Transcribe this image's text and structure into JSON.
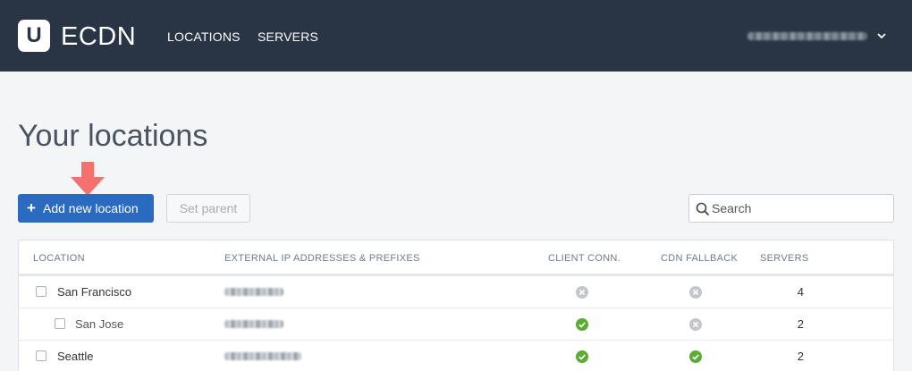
{
  "app": {
    "brand": "ECDN",
    "logo_letter": "U"
  },
  "nav": [
    {
      "label": "LOCATIONS"
    },
    {
      "label": "SERVERS"
    }
  ],
  "page": {
    "title": "Your locations"
  },
  "toolbar": {
    "add_label": "Add new location",
    "set_parent_label": "Set parent"
  },
  "search": {
    "placeholder": "Search"
  },
  "table": {
    "columns": [
      "LOCATION",
      "EXTERNAL IP ADDRESSES & PREFIXES",
      "CLIENT CONN.",
      "CDN FALLBACK",
      "SERVERS"
    ],
    "rows": [
      {
        "location": "San Francisco",
        "client_conn": "disabled",
        "cdn_fallback": "disabled",
        "servers": "4"
      },
      {
        "location": "San Jose",
        "client_conn": "enabled",
        "cdn_fallback": "disabled",
        "servers": "2"
      },
      {
        "location": "Seattle",
        "client_conn": "enabled",
        "cdn_fallback": "enabled",
        "servers": "2"
      }
    ]
  },
  "colors": {
    "header_bg": "#293544",
    "primary": "#2a6bbf",
    "ok": "#5aac35",
    "off": "#c3c7cc",
    "arrow": "#f4726d"
  },
  "icons": {
    "enabled": "check-circle-icon",
    "disabled": "x-circle-icon"
  }
}
